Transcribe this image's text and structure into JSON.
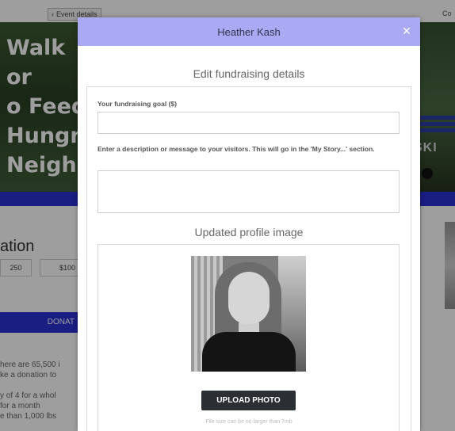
{
  "background_page": {
    "back_link_label": "Event details",
    "back_link_icon": "chevron-left-icon",
    "top_right_text": "Co",
    "hero_title_fragment": "Walk or\no Feed\nHungry\nNeighbo",
    "hero_right_sign": "SKI",
    "donation_heading_fragment": "ation",
    "amount_options": [
      "250",
      "$100"
    ],
    "donate_button_fragment": "DONAT",
    "story_fragment": "here are 65,500 i\nke a donation to\n\ny of 4 for a whol\nfor a month\ne than 1,000 lbs",
    "accent_color": "#2b2fd0"
  },
  "modal": {
    "title": "Heather Kash",
    "close_icon": "close-icon",
    "header_color": "#a9aaf3",
    "section_title": "Edit fundraising details",
    "goal_label": "Your fundraising goal ($)",
    "goal_value": "",
    "description_label": "Enter a description or message to your visitors. This will go in the 'My Story...' section.",
    "description_value": "",
    "profile_image_title": "Updated profile image",
    "profile_image_alt": "profile photo",
    "upload_button_label": "UPLOAD PHOTO",
    "file_size_note": "File size can be no larger than 7mb"
  }
}
